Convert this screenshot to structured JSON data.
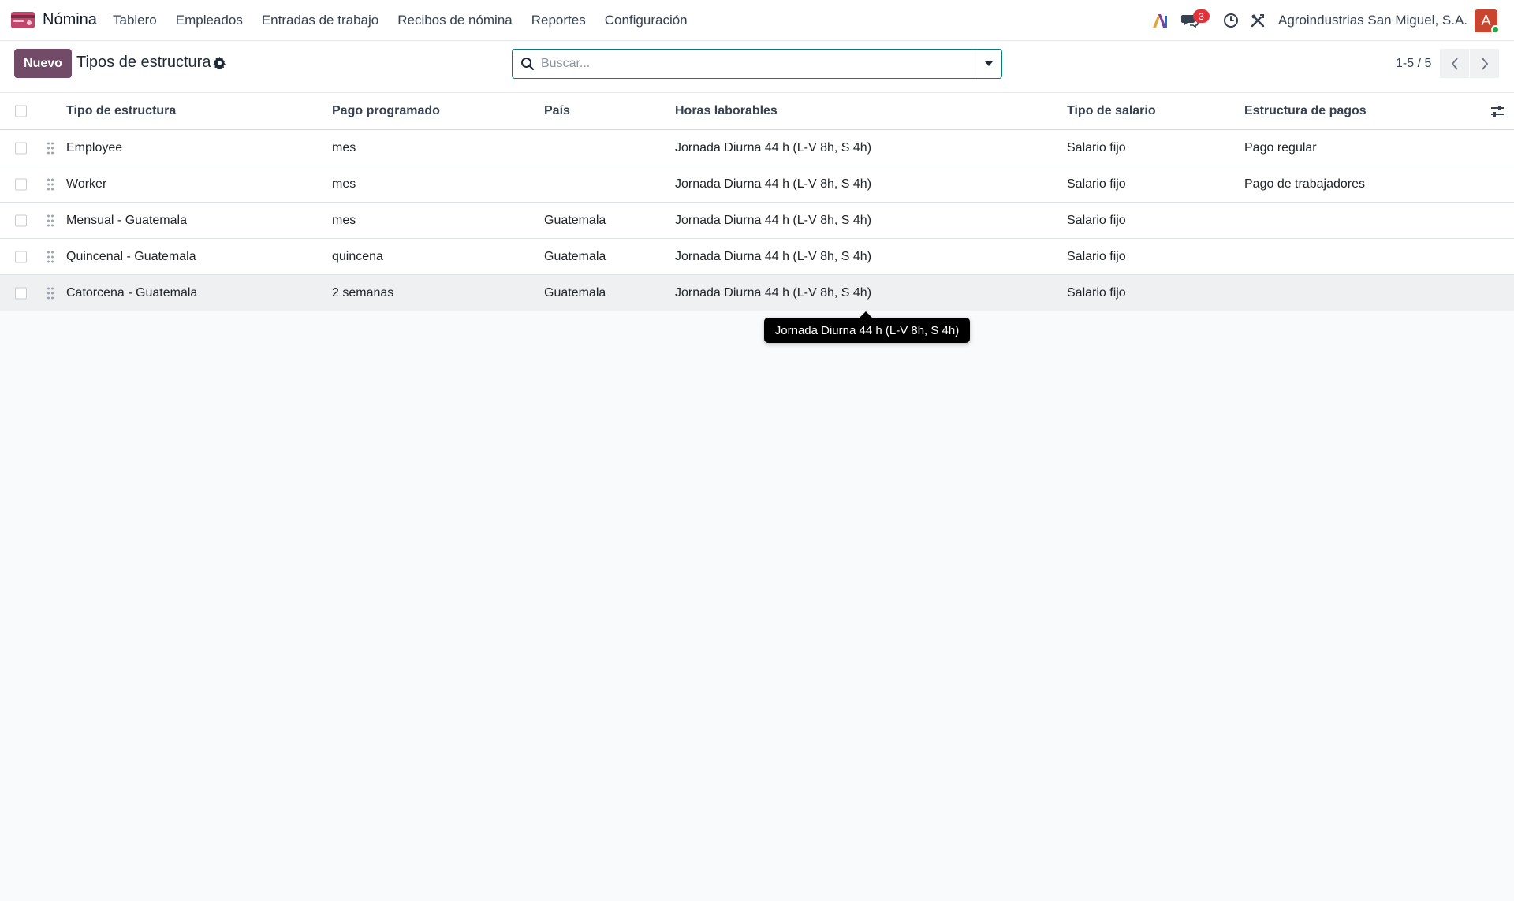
{
  "navbar": {
    "app_name": "Nómina",
    "menu": [
      "Tablero",
      "Empleados",
      "Entradas de trabajo",
      "Recibos de nómina",
      "Reportes",
      "Configuración"
    ],
    "messages_badge": "3",
    "company": "Agroindustrias San Miguel, S.A.",
    "avatar_letter": "A",
    "icons": [
      "payroll-app-icon",
      "ai-icon",
      "chat-icon",
      "clock-icon",
      "tools-icon"
    ],
    "app_icon_color": "#c2456b"
  },
  "control": {
    "new_button": "Nuevo",
    "title": "Tipos de estructura",
    "search_placeholder": "Buscar...",
    "pager": "1-5 / 5",
    "accent": "#714b67",
    "search_border": "#017e84"
  },
  "table": {
    "columns": [
      "Tipo de estructura",
      "Pago programado",
      "País",
      "Horas laborables",
      "Tipo de salario",
      "Estructura de pagos"
    ],
    "rows": [
      {
        "type": "Employee",
        "schedule": "mes",
        "country": "",
        "hours": "Jornada Diurna 44 h (L-V 8h, S 4h)",
        "wage": "Salario fijo",
        "structure": "Pago regular"
      },
      {
        "type": "Worker",
        "schedule": "mes",
        "country": "",
        "hours": "Jornada Diurna 44 h (L-V 8h, S 4h)",
        "wage": "Salario fijo",
        "structure": "Pago de trabajadores"
      },
      {
        "type": "Mensual - Guatemala",
        "schedule": "mes",
        "country": "Guatemala",
        "hours": "Jornada Diurna 44 h (L-V 8h, S 4h)",
        "wage": "Salario fijo",
        "structure": ""
      },
      {
        "type": "Quincenal - Guatemala",
        "schedule": "quincena",
        "country": "Guatemala",
        "hours": "Jornada Diurna 44 h (L-V 8h, S 4h)",
        "wage": "Salario fijo",
        "structure": ""
      },
      {
        "type": "Catorcena - Guatemala",
        "schedule": "2 semanas",
        "country": "Guatemala",
        "hours": "Jornada Diurna 44 h (L-V 8h, S 4h)",
        "wage": "Salario fijo",
        "structure": ""
      }
    ]
  },
  "tooltip": {
    "text": "Jornada Diurna 44 h (L-V 8h, S 4h)"
  }
}
